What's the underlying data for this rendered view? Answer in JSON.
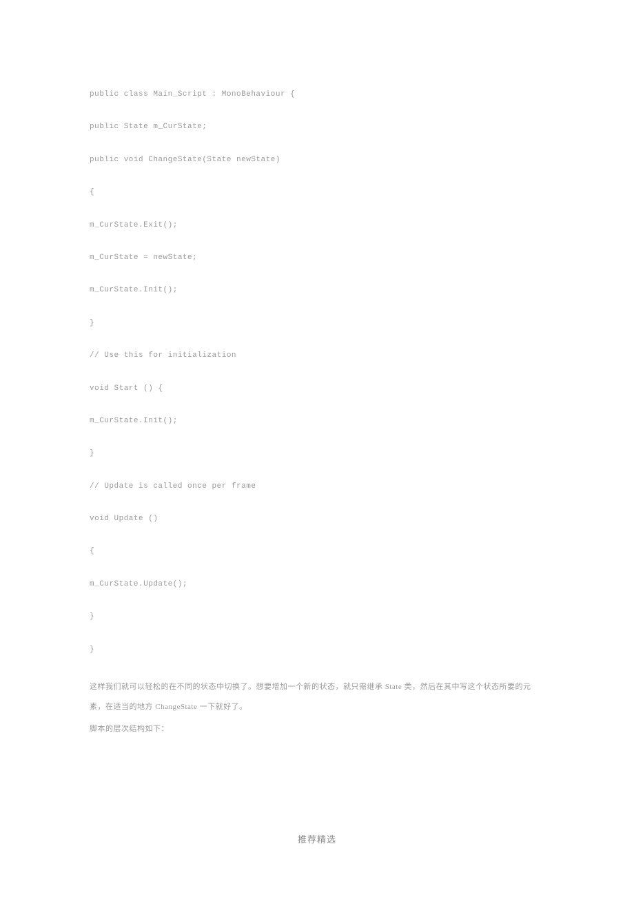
{
  "code": {
    "l1": "public class Main_Script : MonoBehaviour {",
    "l2": "public State m_CurState;",
    "l3": "public void ChangeState(State newState)",
    "l4": "{",
    "l5": "m_CurState.Exit();",
    "l6": "m_CurState = newState;",
    "l7": "m_CurState.Init();",
    "l8": "}",
    "l9": "// Use this for initialization",
    "l10": "void Start () {",
    "l11": "m_CurState.Init();",
    "l12": "}",
    "l13": "// Update is called once per frame",
    "l14": "void Update ()",
    "l15": "{",
    "l16": "m_CurState.Update();",
    "l17": "}",
    "l18": "}"
  },
  "prose": {
    "p1": "这样我们就可以轻松的在不同的状态中切换了。想要增加一个新的状态，就只需继承 State 类，然后在其中写这个状态所要的元素，在适当的地方 ChangeState 一下就好了。",
    "p2": "脚本的层次结构如下："
  },
  "footer": "推荐精选"
}
